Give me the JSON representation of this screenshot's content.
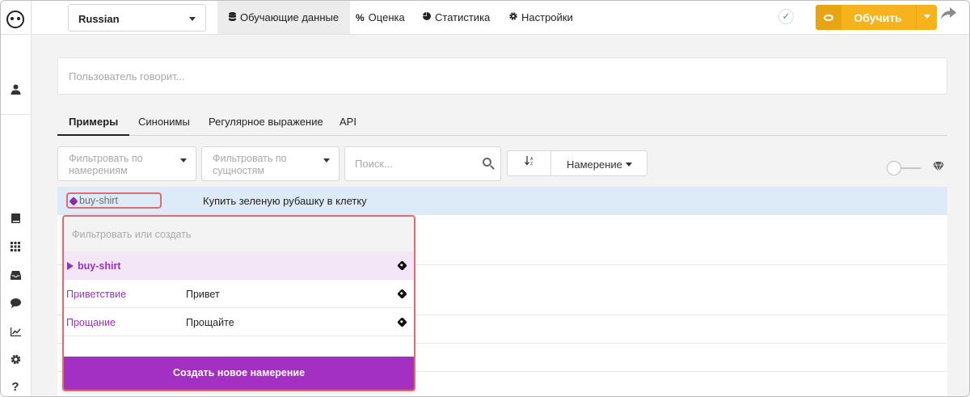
{
  "topbar": {
    "language": "Russian",
    "tabs": [
      {
        "label": "Обучающие данные",
        "icon": "database-icon"
      },
      {
        "label": "Оценка",
        "icon": "percent-icon"
      },
      {
        "label": "Статистика",
        "icon": "pie-chart-icon"
      },
      {
        "label": "Настройки",
        "icon": "gear-icon"
      }
    ],
    "train_label": "Обучить"
  },
  "user_says": {
    "placeholder": "Пользователь говорит..."
  },
  "subtabs": [
    "Примеры",
    "Синонимы",
    "Регулярное выражение",
    "API"
  ],
  "filters": {
    "by_intents": "Фильтровать по намерениям",
    "by_entities": "Фильтровать по сущностям",
    "search_placeholder": "Поиск...",
    "sort_field": "Намерение"
  },
  "examples": [
    {
      "intent": "buy-shirt",
      "text": "Купить зеленую рубашку в клетку"
    }
  ],
  "intent_dropdown": {
    "filter_placeholder": "Фильтровать или создать",
    "current": "buy-shirt",
    "items": [
      {
        "intent": "Приветствие",
        "example": "Привет"
      },
      {
        "intent": "Прощание",
        "example": "Прощайте"
      }
    ],
    "create_label": "Создать новое намерение"
  },
  "colors": {
    "accent": "#a330c3",
    "train": "#f6b31b",
    "selected_row": "#dcebf7"
  }
}
